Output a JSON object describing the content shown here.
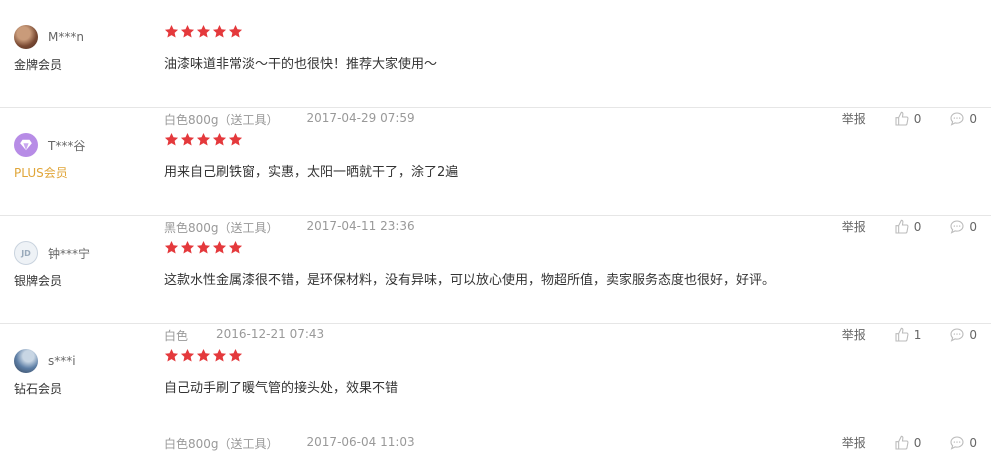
{
  "reviews": [
    {
      "username": "M***n",
      "level": "金牌会员",
      "rating": 5,
      "text": "油漆味道非常淡～干的也很快！推荐大家使用～",
      "variant": "白色800g（送工具）",
      "date": "2017-04-29 07:59",
      "report": "举报",
      "likes": "0",
      "comments": "0"
    },
    {
      "username": "T***谷",
      "level": "PLUS会员",
      "rating": 5,
      "text": "用来自己刷铁窗，实惠，太阳一晒就干了，涂了2遍",
      "variant": "黑色800g（送工具）",
      "date": "2017-04-11 23:36",
      "report": "举报",
      "likes": "0",
      "comments": "0"
    },
    {
      "username": "钟***宁",
      "level": "银牌会员",
      "avatar_text": "JD",
      "rating": 5,
      "text": "这款水性金属漆很不错，是环保材料，没有异味，可以放心使用，物超所值，卖家服务态度也很好，好评。",
      "variant": "白色",
      "date": "2016-12-21 07:43",
      "report": "举报",
      "likes": "1",
      "comments": "0"
    },
    {
      "username": "s***i",
      "level": "钻石会员",
      "rating": 5,
      "text": "自己动手刷了暖气管的接头处，效果不错",
      "variant": "白色800g（送工具）",
      "date": "2017-06-04 11:03",
      "report": "举报",
      "likes": "0",
      "comments": "0"
    }
  ],
  "colors": {
    "star": "#e4393c",
    "plus_level": "#e0a538",
    "meta": "#999999"
  }
}
